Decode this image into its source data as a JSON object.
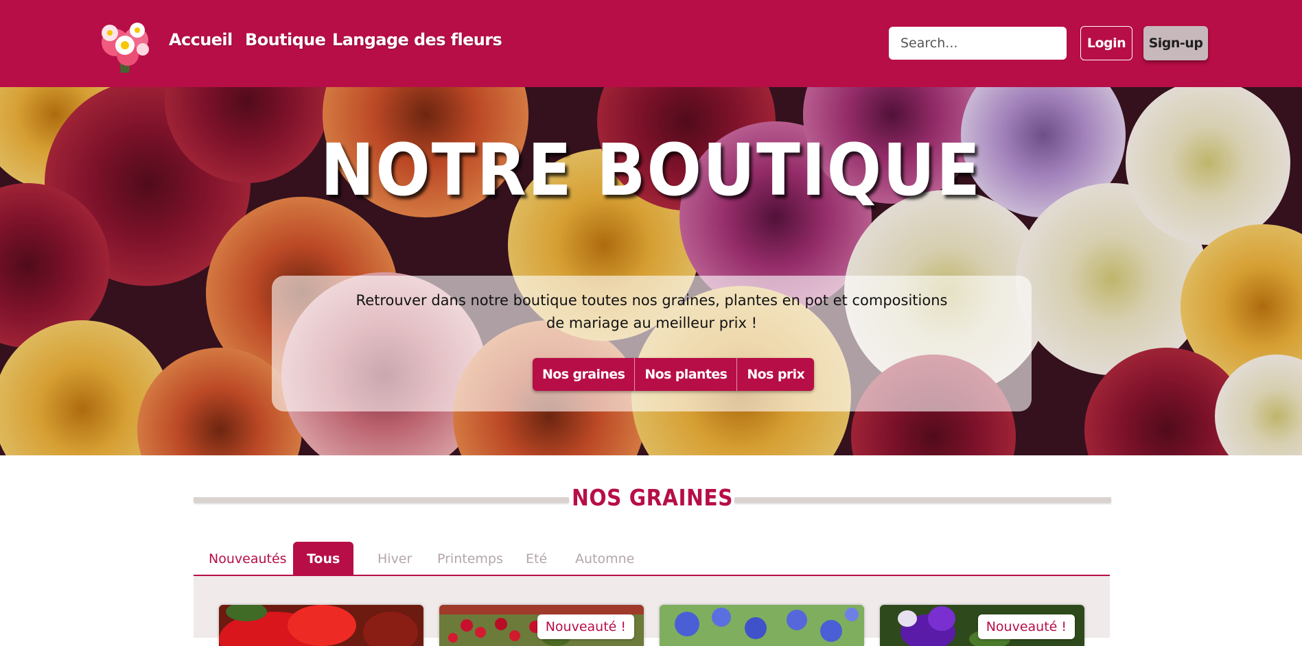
{
  "nav": {
    "links": [
      "Accueil",
      "Boutique",
      "Langage des fleurs"
    ],
    "search_placeholder": "Search...",
    "login_label": "Login",
    "signup_label": "Sign-up"
  },
  "hero": {
    "title": "NOTRE BOUTIQUE",
    "description": "Retrouver dans notre boutique toutes nos graines, plantes en pot et compositions de mariage au meilleur prix !",
    "buttons": [
      "Nos graines",
      "Nos plantes",
      "Nos prix"
    ]
  },
  "section": {
    "title": "NOS GRAINES",
    "tabs": [
      "Nouveautés",
      "Tous",
      "Hiver",
      "Printemps",
      "Eté",
      "Automne"
    ],
    "active_tab": "Tous",
    "cards": [
      {
        "badge": "",
        "image": "red-amaryllis"
      },
      {
        "badge": "Nouveauté !",
        "image": "red-berries"
      },
      {
        "badge": "",
        "image": "blue-cornflowers"
      },
      {
        "badge": "Nouveauté !",
        "image": "purple-iris"
      }
    ]
  },
  "colors": {
    "brand": "#b70e47",
    "signup_bg": "#c7b8bb",
    "grid_bg": "#f0eaea",
    "tab_muted": "#b3a5a8"
  }
}
